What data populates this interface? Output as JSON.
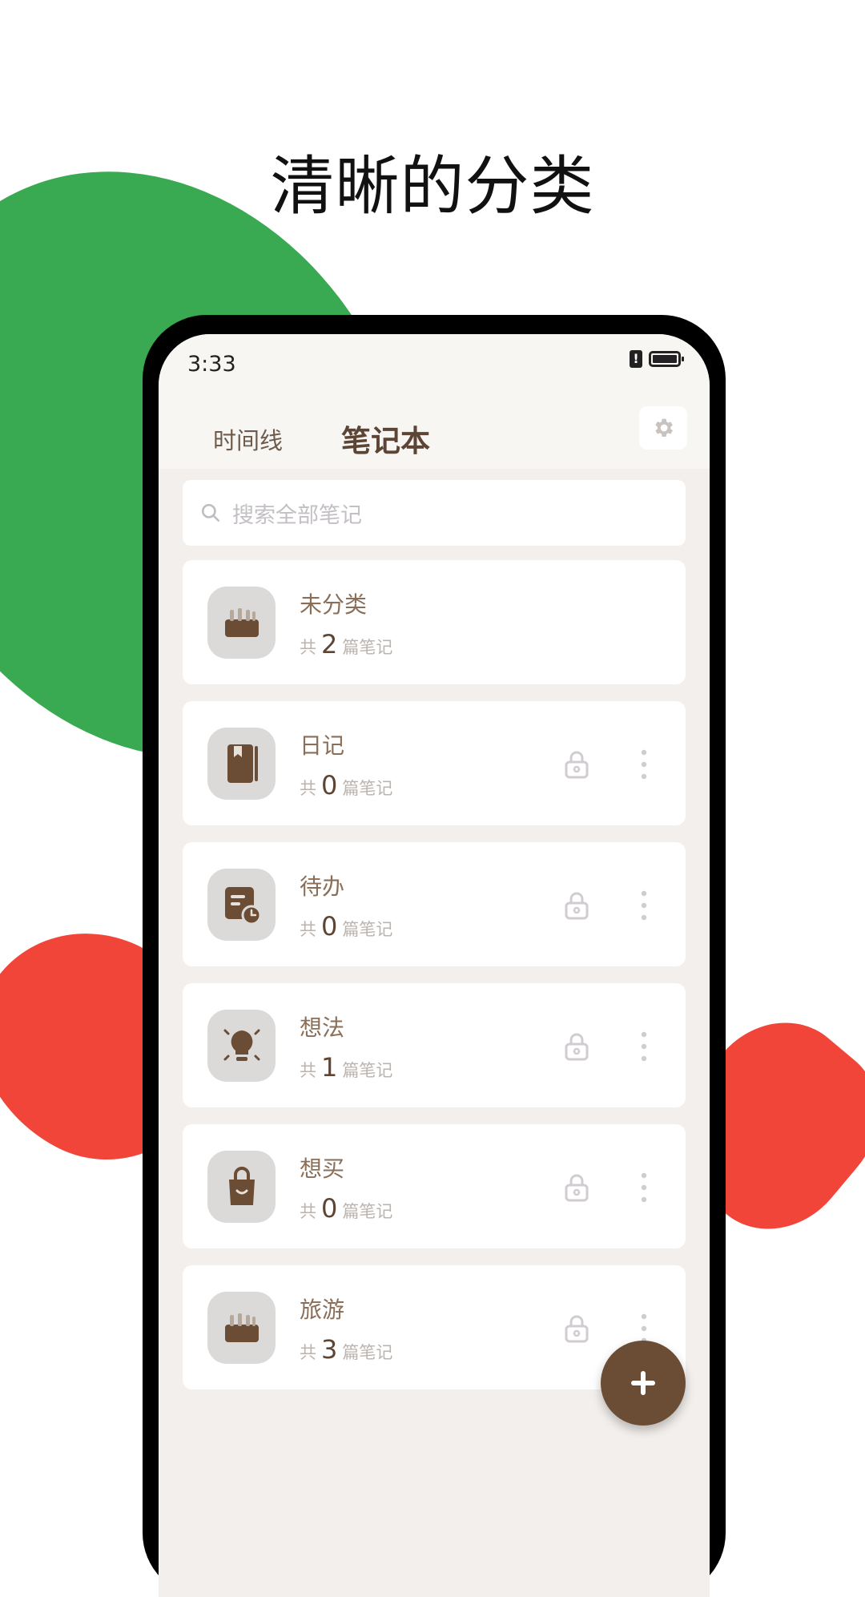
{
  "headline": "清晰的分类",
  "status": {
    "time": "3:33",
    "alert": "!"
  },
  "tabs": {
    "timeline": "时间线",
    "notebook": "笔记本"
  },
  "search": {
    "placeholder": "搜索全部笔记"
  },
  "notebooks": [
    {
      "title": "未分类",
      "count_prefix": "共",
      "count": "2",
      "count_suffix": "篇笔记",
      "icon": "basket-icon"
    },
    {
      "title": "日记",
      "count_prefix": "共",
      "count": "0",
      "count_suffix": "篇笔记",
      "icon": "book-icon"
    },
    {
      "title": "待办",
      "count_prefix": "共",
      "count": "0",
      "count_suffix": "篇笔记",
      "icon": "todo-clock-icon"
    },
    {
      "title": "想法",
      "count_prefix": "共",
      "count": "1",
      "count_suffix": "篇笔记",
      "icon": "lightbulb-icon"
    },
    {
      "title": "想买",
      "count_prefix": "共",
      "count": "0",
      "count_suffix": "篇笔记",
      "icon": "shopping-bag-icon"
    },
    {
      "title": "旅游",
      "count_prefix": "共",
      "count": "3",
      "count_suffix": "篇笔记",
      "icon": "basket-icon"
    }
  ],
  "colors": {
    "green": "#3aaa52",
    "red": "#f2453a",
    "brown": "#6b4d35",
    "background": "#f3efec"
  }
}
